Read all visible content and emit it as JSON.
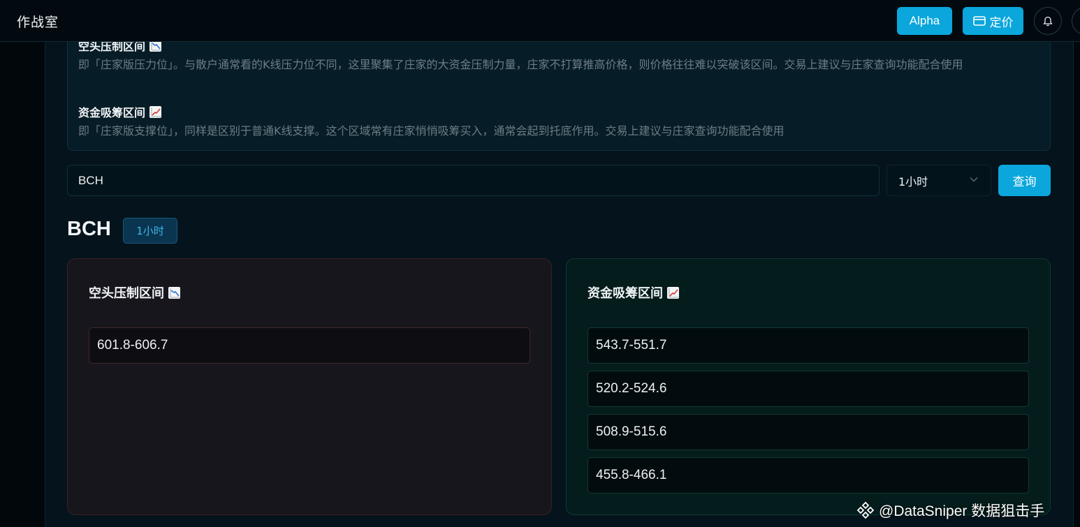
{
  "header": {
    "app_title": "作战室",
    "alpha_label": "Alpha",
    "pricing_label": "定价"
  },
  "info": {
    "short_zone_title": "空头压制区间",
    "short_zone_desc": "即「庄家版压力位」。与散户通常看的K线压力位不同，这里聚集了庄家的大资金压制力量，庄家不打算推高价格，则价格往往难以突破该区间。交易上建议与庄家查询功能配合使用",
    "long_zone_title": "资金吸筹区间",
    "long_zone_desc": "即「庄家版支撑位」，同样是区别于普通K线支撑。这个区域常有庄家悄悄吸筹买入，通常会起到托底作用。交易上建议与庄家查询功能配合使用"
  },
  "search": {
    "value": "BCH",
    "interval": "1小时",
    "query_label": "查询"
  },
  "result": {
    "symbol": "BCH",
    "interval_badge": "1小时",
    "short_panel": {
      "title": "空头压制区间",
      "zones": [
        "601.8-606.7"
      ]
    },
    "long_panel": {
      "title": "资金吸筹区间",
      "zones": [
        "543.7-551.7",
        "520.2-524.6",
        "508.9-515.6",
        "455.8-466.1"
      ]
    }
  },
  "watermark": "@DataSniper 数据狙击手",
  "colors": {
    "accent": "#0aa6dc",
    "background": "#04131c",
    "short_panel_bg": "#17161c",
    "long_panel_bg": "#041c1c"
  },
  "icons": [
    "chart-decreasing-icon",
    "chart-increasing-icon",
    "card-icon",
    "bell-icon",
    "chevron-down-icon"
  ]
}
